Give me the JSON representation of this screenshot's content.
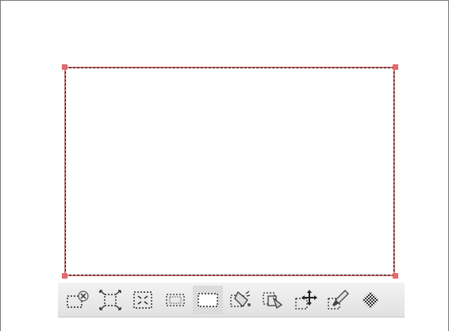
{
  "toolbar": {
    "tools": [
      {
        "icon": "selection-cancel-icon"
      },
      {
        "icon": "selection-expand-icon"
      },
      {
        "icon": "selection-shrink-icon"
      },
      {
        "icon": "selection-border-icon"
      },
      {
        "icon": "selection-rectangle-icon",
        "selected": true
      },
      {
        "icon": "selection-fill-icon"
      },
      {
        "icon": "selection-copy-icon"
      },
      {
        "icon": "selection-move-icon"
      },
      {
        "icon": "selection-brush-icon"
      },
      {
        "icon": "selection-pattern-icon"
      }
    ]
  },
  "colors": {
    "selection_outline": "#e37b7b",
    "handle": "#e26b6b",
    "marquee": "#000000"
  }
}
